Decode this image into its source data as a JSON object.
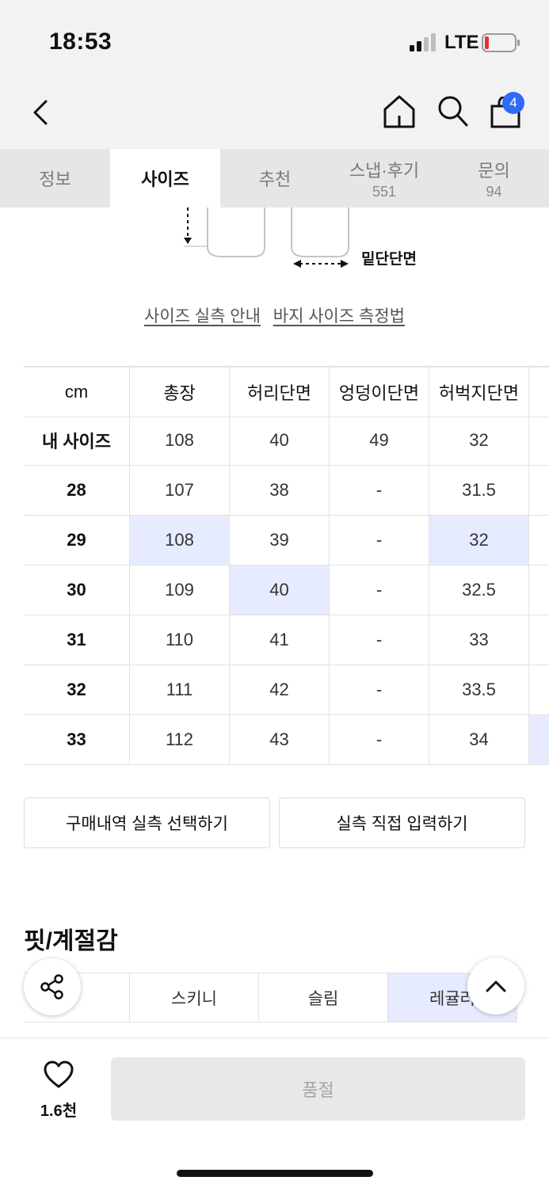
{
  "status_bar": {
    "time": "18:53",
    "network": "LTE"
  },
  "header": {
    "cart_count": "4"
  },
  "tabs": [
    {
      "label": "정보",
      "count": ""
    },
    {
      "label": "사이즈",
      "count": ""
    },
    {
      "label": "추천",
      "count": ""
    },
    {
      "label": "스냅·후기",
      "count": "551"
    },
    {
      "label": "문의",
      "count": "94"
    }
  ],
  "diagram": {
    "label": "밑단단면"
  },
  "guide_links": {
    "measure_guide": "사이즈 실측 안내",
    "pants_measure": "바지 사이즈 측정법"
  },
  "size_table": {
    "headers": [
      "cm",
      "총장",
      "허리단면",
      "엉덩이단면",
      "허벅지단면"
    ],
    "rows": [
      [
        "내 사이즈",
        "108",
        "40",
        "49",
        "32"
      ],
      [
        "28",
        "107",
        "38",
        "-",
        "31.5"
      ],
      [
        "29",
        "108",
        "39",
        "-",
        "32"
      ],
      [
        "30",
        "109",
        "40",
        "-",
        "32.5"
      ],
      [
        "31",
        "110",
        "41",
        "-",
        "33"
      ],
      [
        "32",
        "111",
        "42",
        "-",
        "33.5"
      ],
      [
        "33",
        "112",
        "43",
        "-",
        "34"
      ]
    ]
  },
  "buttons": {
    "purchase_history": "구매내역 실측 선택하기",
    "manual_input": "실측 직접 입력하기"
  },
  "fit_section": {
    "title": "핏/계절감",
    "options": [
      "스키니",
      "슬림",
      "레귤러"
    ]
  },
  "bottom_bar": {
    "like_count": "1.6천",
    "soldout_label": "품절"
  },
  "colors": {
    "highlight": "#e6ebff",
    "badge": "#2f6bf5"
  }
}
